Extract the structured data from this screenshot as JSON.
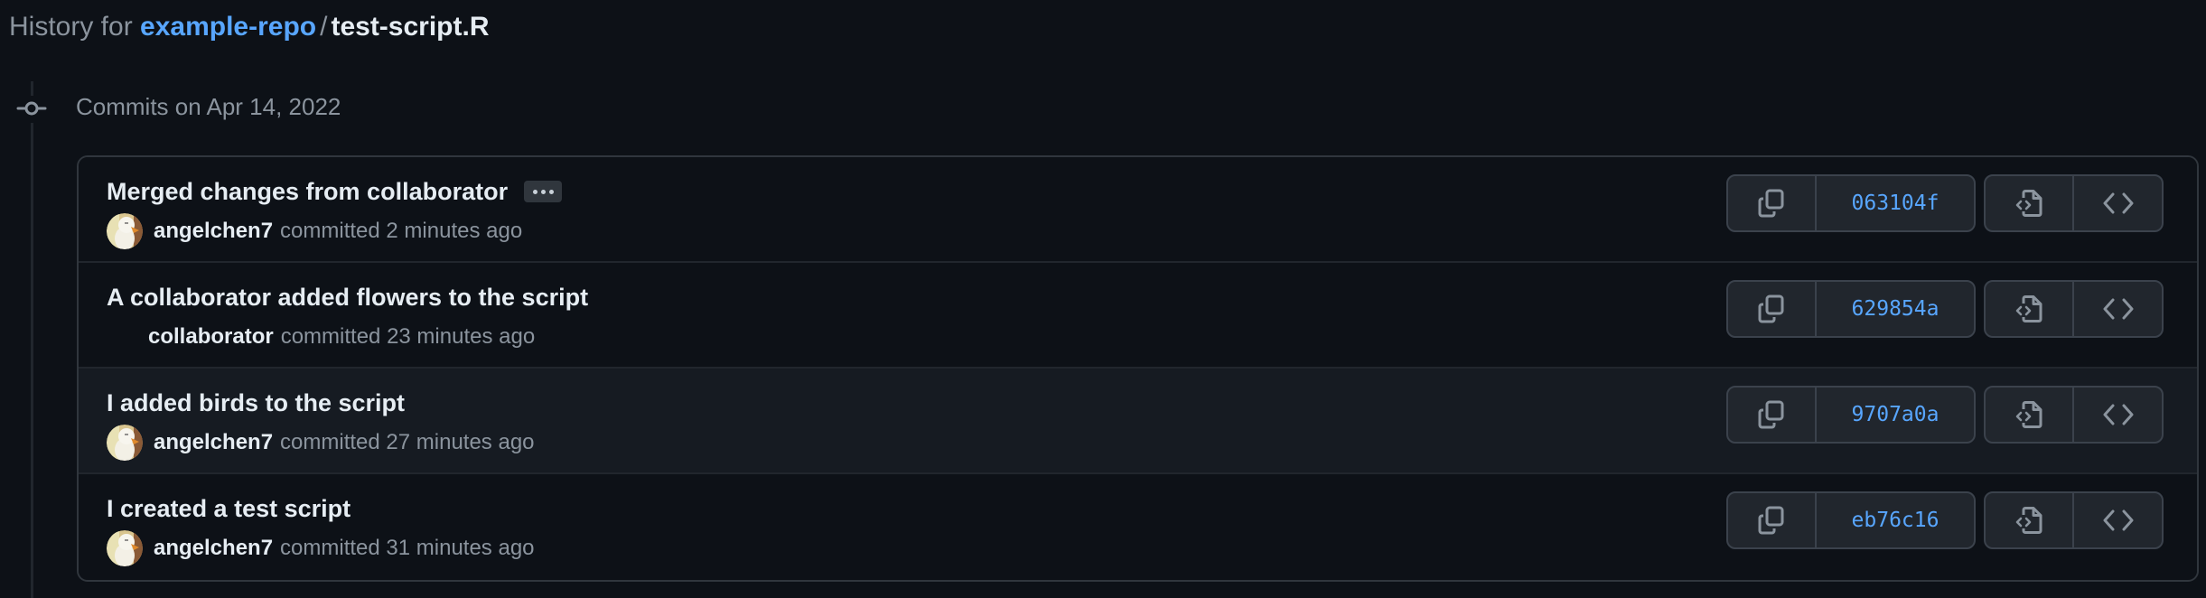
{
  "header": {
    "prefix": "History for",
    "repo": "example-repo",
    "separator": "/",
    "file": "test-script.R"
  },
  "timeline": {
    "heading": "Commits on Apr 14, 2022"
  },
  "colors": {
    "background": "#0d1117",
    "link": "#58a6ff",
    "border": "#30363d",
    "muted_text": "#8b949e",
    "primary_text": "#e6edf3",
    "row_hover": "#161b22"
  },
  "commits": [
    {
      "message": "Merged changes from collaborator",
      "has_ellipsis": true,
      "author": "angelchen7",
      "has_avatar": true,
      "committed_text": "committed 2 minutes ago",
      "sha": "063104f",
      "hovered": false
    },
    {
      "message": "A collaborator added flowers to the script",
      "has_ellipsis": false,
      "author": "collaborator",
      "has_avatar": false,
      "committed_text": "committed 23 minutes ago",
      "sha": "629854a",
      "hovered": false
    },
    {
      "message": "I added birds to the script",
      "has_ellipsis": false,
      "author": "angelchen7",
      "has_avatar": true,
      "committed_text": "committed 27 minutes ago",
      "sha": "9707a0a",
      "hovered": true
    },
    {
      "message": "I created a test script",
      "has_ellipsis": false,
      "author": "angelchen7",
      "has_avatar": true,
      "committed_text": "committed 31 minutes ago",
      "sha": "eb76c16",
      "hovered": false
    }
  ],
  "icons": {
    "timeline": "git-commit-icon",
    "copy": "copy-icon",
    "view_file": "file-code-icon",
    "browse": "code-icon",
    "more": "kebab-horizontal-icon"
  }
}
